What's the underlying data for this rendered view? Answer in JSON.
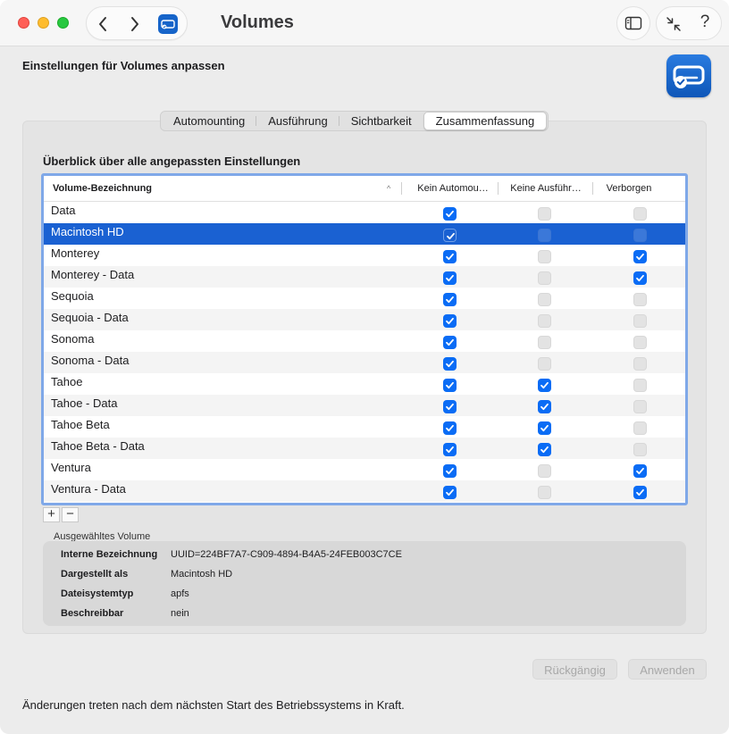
{
  "window": {
    "title": "Volumes"
  },
  "header": {
    "subtitle": "Einstellungen für Volumes anpassen"
  },
  "tabs": [
    {
      "label": "Automounting",
      "active": false
    },
    {
      "label": "Ausführung",
      "active": false
    },
    {
      "label": "Sichtbarkeit",
      "active": false
    },
    {
      "label": "Zusammenfassung",
      "active": true
    }
  ],
  "section_title": "Überblick über alle angepassten Einstellungen",
  "table": {
    "columns": [
      "Volume-Bezeichnung",
      "Kein Automou…",
      "Keine Ausführ…",
      "Verborgen"
    ],
    "sort_indicator": "^",
    "rows": [
      {
        "name": "Data",
        "no_automount": true,
        "no_exec": false,
        "hidden": false,
        "selected": false
      },
      {
        "name": "Macintosh HD",
        "no_automount": true,
        "no_exec": false,
        "hidden": false,
        "selected": true
      },
      {
        "name": "Monterey",
        "no_automount": true,
        "no_exec": false,
        "hidden": true,
        "selected": false
      },
      {
        "name": "Monterey - Data",
        "no_automount": true,
        "no_exec": false,
        "hidden": true,
        "selected": false
      },
      {
        "name": "Sequoia",
        "no_automount": true,
        "no_exec": false,
        "hidden": false,
        "selected": false
      },
      {
        "name": "Sequoia - Data",
        "no_automount": true,
        "no_exec": false,
        "hidden": false,
        "selected": false
      },
      {
        "name": "Sonoma",
        "no_automount": true,
        "no_exec": false,
        "hidden": false,
        "selected": false
      },
      {
        "name": "Sonoma - Data",
        "no_automount": true,
        "no_exec": false,
        "hidden": false,
        "selected": false
      },
      {
        "name": "Tahoe",
        "no_automount": true,
        "no_exec": true,
        "hidden": false,
        "selected": false
      },
      {
        "name": "Tahoe - Data",
        "no_automount": true,
        "no_exec": true,
        "hidden": false,
        "selected": false
      },
      {
        "name": "Tahoe Beta",
        "no_automount": true,
        "no_exec": true,
        "hidden": false,
        "selected": false
      },
      {
        "name": "Tahoe Beta - Data",
        "no_automount": true,
        "no_exec": true,
        "hidden": false,
        "selected": false
      },
      {
        "name": "Ventura",
        "no_automount": true,
        "no_exec": false,
        "hidden": true,
        "selected": false
      },
      {
        "name": "Ventura - Data",
        "no_automount": true,
        "no_exec": false,
        "hidden": true,
        "selected": false
      }
    ]
  },
  "list_controls": {
    "add": "+",
    "remove": "−"
  },
  "selected_volume": {
    "label": "Ausgewähltes Volume",
    "fields": [
      {
        "key": "Interne Bezeichnung",
        "value": "UUID=224BF7A7-C909-4894-B4A5-24FEB003C7CE"
      },
      {
        "key": "Dargestellt als",
        "value": "Macintosh HD"
      },
      {
        "key": "Dateisystemtyp",
        "value": "apfs"
      },
      {
        "key": "Beschreibbar",
        "value": "nein"
      }
    ]
  },
  "buttons": {
    "undo": "Rückgängig",
    "apply": "Anwenden"
  },
  "footer": "Änderungen treten nach dem nächsten Start des Betriebssystems in Kraft.",
  "toolbar": {
    "help": "?"
  },
  "colors": {
    "accent": "#0a6cf5",
    "selection": "#1a61d2",
    "close": "#ff5f57",
    "minimize": "#febc2e",
    "maximize": "#28c840"
  },
  "icons": [
    "back-chevron-icon",
    "forward-chevron-icon",
    "volume-app-icon",
    "sidebar-toggle-icon",
    "collapse-arrows-icon",
    "help-icon",
    "checkmark-icon"
  ]
}
